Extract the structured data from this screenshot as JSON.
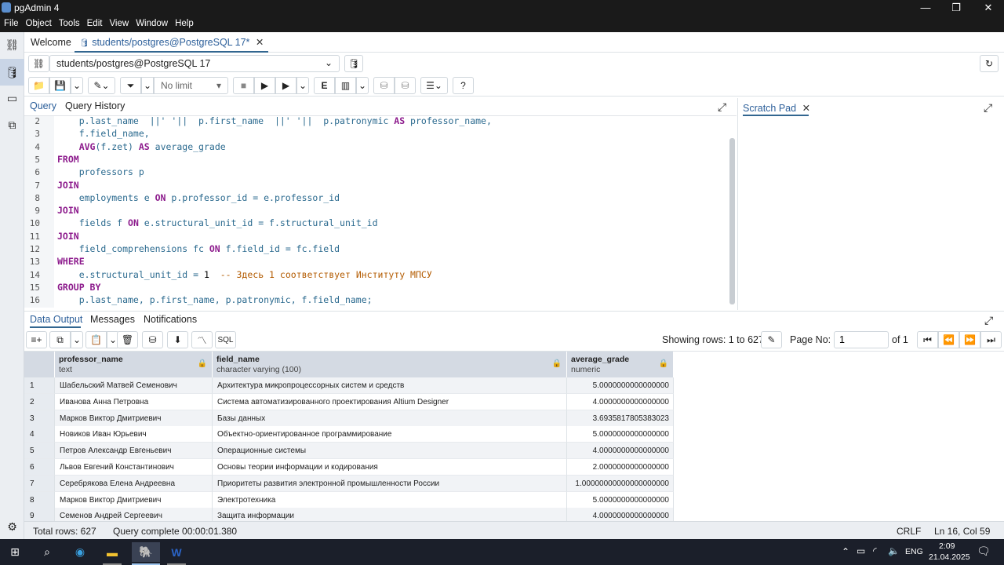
{
  "window": {
    "title": "pgAdmin 4",
    "minimize": "—",
    "maximize": "❐",
    "close": "✕"
  },
  "menu": [
    "File",
    "Object",
    "Tools",
    "Edit",
    "View",
    "Window",
    "Help"
  ],
  "tabs": [
    {
      "label": "Welcome"
    },
    {
      "label": "students/postgres@PostgreSQL 17*",
      "close": "✕"
    }
  ],
  "connection": {
    "value": "students/postgres@PostgreSQL 17"
  },
  "toolbar": {
    "limit": "No limit"
  },
  "query_tabs": [
    "Query",
    "Query History"
  ],
  "scratch": {
    "label": "Scratch Pad",
    "close": "✕"
  },
  "editor_lines": [
    {
      "n": "2",
      "html": "    p.last_name  ||' '||  p.first_name  ||' '||  p.patronymic <span class=\"kw\">AS</span> professor_name,"
    },
    {
      "n": "3",
      "html": "    f.field_name,"
    },
    {
      "n": "4",
      "html": "    <span class=\"kw\">AVG</span>(f.zet) <span class=\"kw\">AS</span> average_grade"
    },
    {
      "n": "5",
      "html": "<span class=\"kw\">FROM</span>"
    },
    {
      "n": "6",
      "html": "    professors p"
    },
    {
      "n": "7",
      "html": "<span class=\"kw\">JOIN</span>"
    },
    {
      "n": "8",
      "html": "    employments e <span class=\"kw\">ON</span> p.professor_id = e.professor_id"
    },
    {
      "n": "9",
      "html": "<span class=\"kw\">JOIN</span>"
    },
    {
      "n": "10",
      "html": "    fields f <span class=\"kw\">ON</span> e.structural_unit_id = f.structural_unit_id"
    },
    {
      "n": "11",
      "html": "<span class=\"kw\">JOIN</span>"
    },
    {
      "n": "12",
      "html": "    field_comprehensions fc <span class=\"kw\">ON</span> f.field_id = fc.field"
    },
    {
      "n": "13",
      "html": "<span class=\"kw\">WHERE</span>"
    },
    {
      "n": "14",
      "html": "    e.structural_unit_id = <span class=\"nu\">1</span>  <span class=\"cm\">-- Здесь 1 соответствует Институту МПСУ</span>"
    },
    {
      "n": "15",
      "html": "<span class=\"kw\">GROUP BY</span>"
    },
    {
      "n": "16",
      "html": "    p.last_name, p.first_name, p.patronymic, f.field_name;"
    }
  ],
  "output_tabs": [
    "Data Output",
    "Messages",
    "Notifications"
  ],
  "output_toolbar": {
    "sql": "SQL",
    "showing": "Showing rows: 1 to 627",
    "page_no_label": "Page No:",
    "page_no": "1",
    "of": "of 1"
  },
  "columns": [
    {
      "name": "professor_name",
      "type": "text"
    },
    {
      "name": "field_name",
      "type": "character varying (100)"
    },
    {
      "name": "average_grade",
      "type": "numeric"
    }
  ],
  "rows": [
    [
      "1",
      "Шабельский Матвей Семенович",
      "Архитектура микропроцессорных систем и средств",
      "5.0000000000000000"
    ],
    [
      "2",
      "Иванова Анна Петровна",
      "Система автоматизированного проектирования Altium Designer",
      "4.0000000000000000"
    ],
    [
      "3",
      "Марков Виктор Дмитриевич",
      "Базы данных",
      "3.6935817805383023"
    ],
    [
      "4",
      "Новиков Иван Юрьевич",
      "Объектно-ориентированное программирование",
      "5.0000000000000000"
    ],
    [
      "5",
      "Петров Александр Евгеньевич",
      "Операционные системы",
      "4.0000000000000000"
    ],
    [
      "6",
      "Львов Евгений Константинович",
      "Основы теории информации и кодирования",
      "2.0000000000000000"
    ],
    [
      "7",
      "Серебрякова Елена Андреевна",
      "Приоритеты развития электронной промышленности России",
      "1.00000000000000000000"
    ],
    [
      "8",
      "Марков Виктор Дмитриевич",
      "Электротехника",
      "5.0000000000000000"
    ],
    [
      "9",
      "Семенов Андрей Сергеевич",
      "Защита информации",
      "4.0000000000000000"
    ]
  ],
  "status": {
    "total_rows": "Total rows: 627",
    "query_complete": "Query complete 00:00:01.380",
    "eol": "CRLF",
    "position": "Ln 16, Col 59"
  },
  "taskbar": {
    "lang": "ENG",
    "time": "2:09",
    "date": "21.04.2025"
  }
}
